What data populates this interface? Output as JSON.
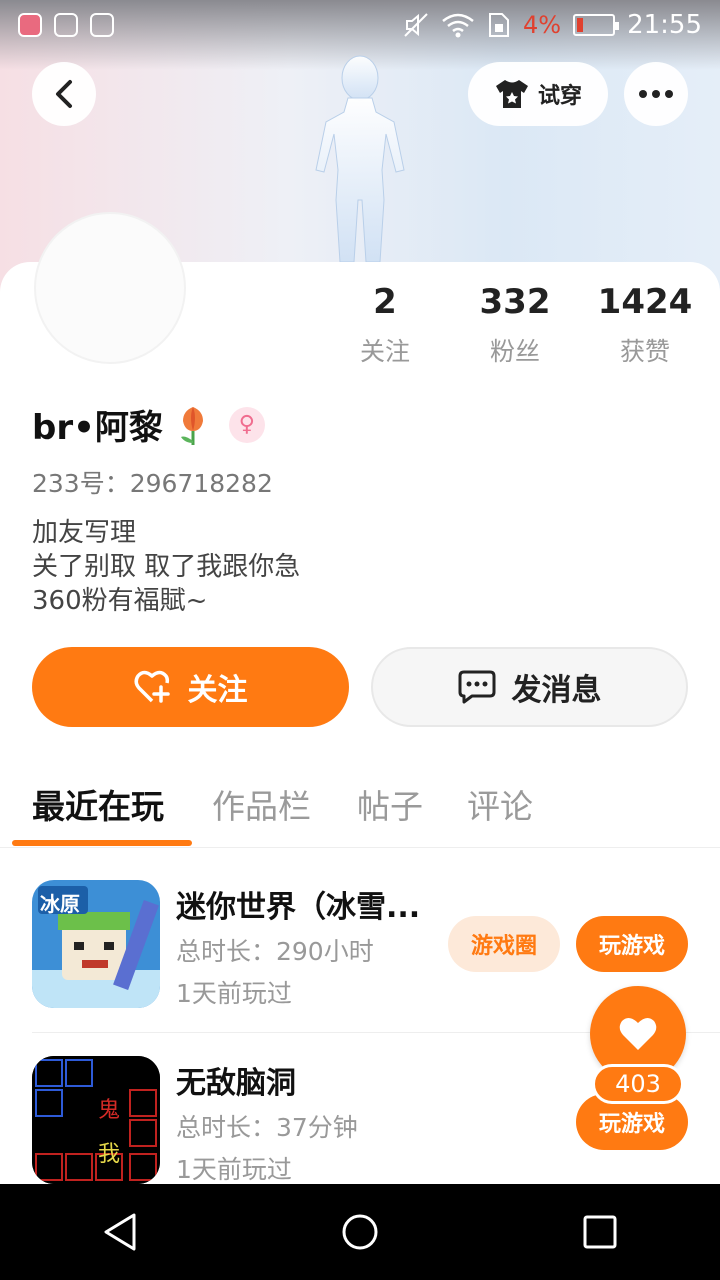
{
  "status_bar": {
    "battery_percent": "4%",
    "time": "21:55"
  },
  "header": {
    "try_on_label": "试穿"
  },
  "profile": {
    "stats": [
      {
        "value": "2",
        "label": "关注"
      },
      {
        "value": "332",
        "label": "粉丝"
      },
      {
        "value": "1424",
        "label": "获赞"
      }
    ],
    "username": "br•阿黎",
    "uid": "233号：296718282",
    "bio_lines": [
      "加友写理",
      "关了别取 取了我跟你急",
      "360粉有福賦~"
    ]
  },
  "actions": {
    "follow_label": "关注",
    "message_label": "发消息"
  },
  "tabs": [
    {
      "label": "最近在玩",
      "active": true
    },
    {
      "label": "作品栏",
      "active": false
    },
    {
      "label": "帖子",
      "active": false
    },
    {
      "label": "评论",
      "active": false
    }
  ],
  "games": [
    {
      "title": "迷你世界（冰雪...",
      "duration": "总时长：290小时",
      "last_played": "1天前玩过",
      "circle_label": "游戏圈",
      "play_label": "玩游戏",
      "icon_text": "冰原"
    },
    {
      "title": "无敌脑洞",
      "duration": "总时长：37分钟",
      "last_played": "1天前玩过",
      "play_label": "玩游戏",
      "icon_text_1": "鬼",
      "icon_text_2": "我"
    }
  ],
  "like": {
    "count": "403"
  },
  "colors": {
    "accent": "#ff7a12",
    "accent_light": "#fde9d9"
  }
}
